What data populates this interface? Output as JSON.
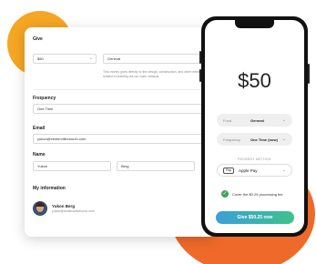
{
  "give_form": {
    "give_label": "Give",
    "amount_value": "$50",
    "fund_value": "General",
    "fund_note": "This money goes directly to the design, construction, and other needs related to building out our main campus.",
    "frequency_label": "Frequency",
    "frequency_value": "One Time",
    "email_label": "Email",
    "email_value": "yukon@centervillechurch.com",
    "name_label": "Name",
    "first_name": "Yukon",
    "last_name": "Berg",
    "my_info_label": "My information",
    "user_name": "Yukon Berg",
    "user_email": "yukon@centervillechurch.com"
  },
  "phone": {
    "amount": "$50",
    "fund_key": "Fund",
    "fund_value": "General",
    "frequency_key": "Frequency",
    "frequency_value": "One Time (now)",
    "payment_method_label": "PAYMENT METHOD",
    "payment_badge": "Pay",
    "payment_value": "Apple Pay",
    "cover_text": "Cover the $0.25 processing fee",
    "give_button": "Give $50.25 now"
  },
  "colors": {
    "accent_yellow": "#f5a623",
    "accent_orange": "#ef6a2a",
    "button_gradient_start": "#3aa0d8",
    "button_gradient_end": "#3ec28c",
    "check_green": "#3aa655"
  },
  "icons": [
    "chevron-down-icon",
    "check-circle-icon",
    "apple-pay-icon",
    "avatar"
  ]
}
